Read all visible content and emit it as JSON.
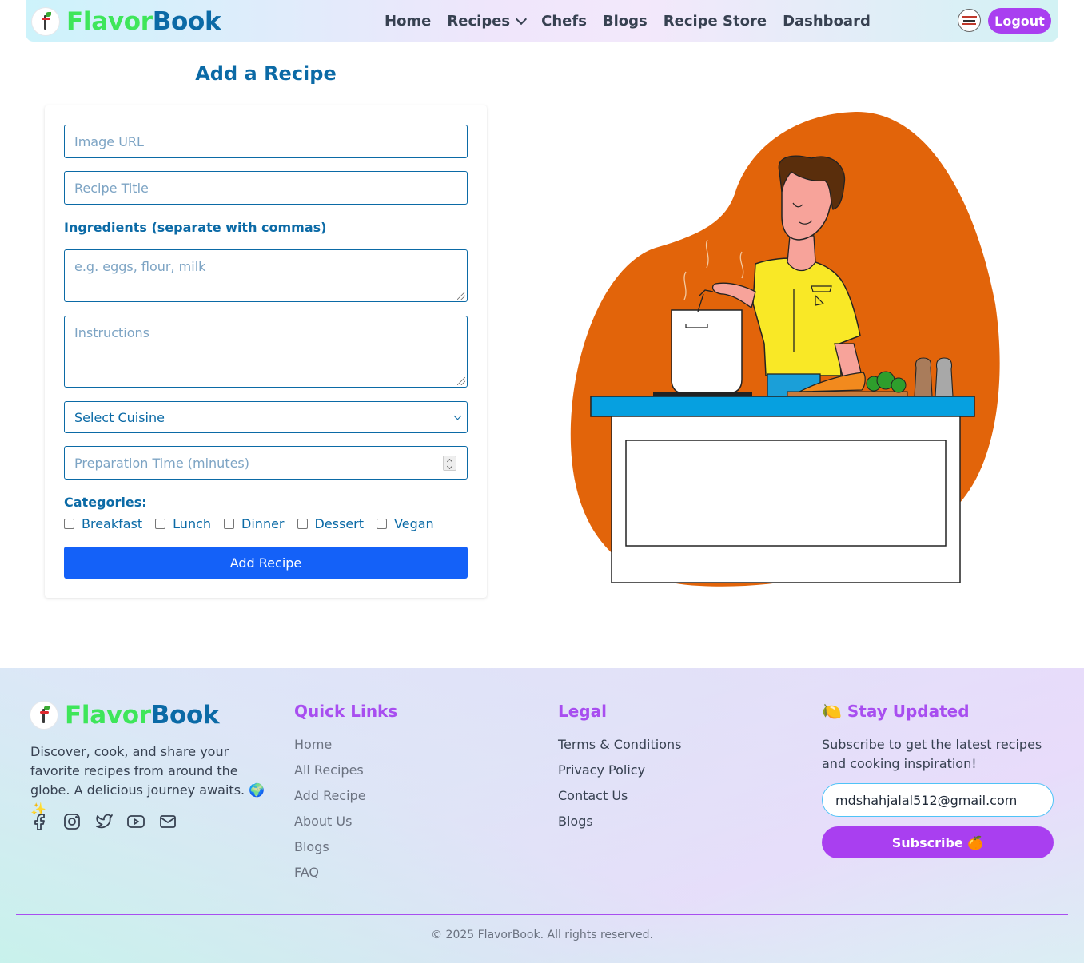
{
  "nav": {
    "brand_part1": "Flavor",
    "brand_part2": "Book",
    "links": [
      "Home",
      "Recipes",
      "Chefs",
      "Blogs",
      "Recipe Store",
      "Dashboard"
    ],
    "logout_label": "Logout"
  },
  "form": {
    "title": "Add a Recipe",
    "image_url_placeholder": "Image URL",
    "recipe_title_placeholder": "Recipe Title",
    "ingredients_label": "Ingredients (separate with commas)",
    "ingredients_placeholder": "e.g. eggs, flour, milk",
    "instructions_placeholder": "Instructions",
    "cuisine_selected": "Select Cuisine",
    "prep_time_placeholder": "Preparation Time (minutes)",
    "categories_label": "Categories:",
    "categories": [
      "Breakfast",
      "Lunch",
      "Dinner",
      "Dessert",
      "Vegan"
    ],
    "submit_label": "Add Recipe"
  },
  "footer": {
    "brand_part1": "Flavor",
    "brand_part2": "Book",
    "description": "Discover, cook, and share your favorite recipes from around the globe. A delicious journey awaits. 🌍✨",
    "social_icons": [
      "facebook-icon",
      "instagram-icon",
      "twitter-icon",
      "youtube-icon",
      "mail-icon"
    ],
    "quick_links_title": "Quick Links",
    "quick_links": [
      "Home",
      "All Recipes",
      "Add Recipe",
      "About Us",
      "Blogs",
      "FAQ"
    ],
    "legal_title": "Legal",
    "legal_links": [
      "Terms & Conditions",
      "Privacy Policy",
      "Contact Us",
      "Blogs"
    ],
    "stay_updated_title": "🍋 Stay Updated",
    "stay_updated_desc": "Subscribe to get the latest recipes and cooking inspiration!",
    "email_value": "mdshahjalal512@gmail.com",
    "subscribe_label": "Subscribe 🍊",
    "copyright": "© 2025 FlavorBook. All rights reserved."
  },
  "colors": {
    "brand_green": "#3ee65a",
    "brand_blue": "#0b6aa6",
    "accent_purple": "#a93ff0",
    "primary_button": "#1461f8",
    "blob_orange": "#e2640a"
  }
}
